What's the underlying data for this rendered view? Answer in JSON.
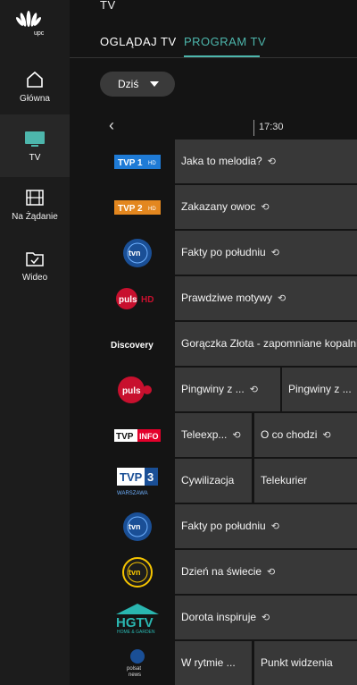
{
  "brand": {
    "logo_text": "upc"
  },
  "sidebar": {
    "items": [
      {
        "label": "Główna",
        "icon": "home-icon"
      },
      {
        "label": "TV",
        "icon": "tv-icon",
        "active": true
      },
      {
        "label": "Na Żądanie",
        "icon": "film-icon"
      },
      {
        "label": "Wideo",
        "icon": "folder-check-icon"
      }
    ]
  },
  "header": {
    "title": "TV",
    "tabs": [
      {
        "label": "OGLĄDAJ TV"
      },
      {
        "label": "PROGRAM TV",
        "active": true
      }
    ]
  },
  "day_selector": {
    "value": "Dziś"
  },
  "timeline": {
    "time": "17:30"
  },
  "colors": {
    "accent": "#4db6ac",
    "program_bg": "#383838"
  },
  "channels": [
    {
      "logo": "TVP 1 HD",
      "programs": [
        {
          "title": "Jaka to melodia?",
          "replay": true
        }
      ]
    },
    {
      "logo": "TVP 2 HD",
      "programs": [
        {
          "title": "Zakazany owoc",
          "replay": true
        }
      ]
    },
    {
      "logo": "tvn24",
      "programs": [
        {
          "title": "Fakty po południu",
          "replay": true
        }
      ]
    },
    {
      "logo": "puls HD",
      "programs": [
        {
          "title": "Prawdziwe motywy",
          "replay": true
        }
      ]
    },
    {
      "logo": "Discovery",
      "programs": [
        {
          "title": "Gorączka Złota - zapomniane kopalnie",
          "replay": false
        }
      ]
    },
    {
      "logo": "puls 2",
      "programs": [
        {
          "title": "Pingwiny z ...",
          "replay": true
        },
        {
          "title": "Pingwiny z ...",
          "replay": true
        }
      ]
    },
    {
      "logo": "TVP INFO",
      "programs": [
        {
          "title": "Teleexp...",
          "replay": true
        },
        {
          "title": "O co chodzi",
          "replay": true
        }
      ]
    },
    {
      "logo": "TVP 3 WARSZAWA",
      "programs": [
        {
          "title": "Cywilizacja",
          "replay": false
        },
        {
          "title": "Telekurier",
          "replay": false
        }
      ]
    },
    {
      "logo": "tvn24",
      "programs": [
        {
          "title": "Fakty po południu",
          "replay": true
        }
      ]
    },
    {
      "logo": "tvn24 bis",
      "programs": [
        {
          "title": "Dzień na świecie",
          "replay": true
        }
      ]
    },
    {
      "logo": "HGTV HOME & GARDEN",
      "programs": [
        {
          "title": "Dorota inspiruje",
          "replay": true
        }
      ]
    },
    {
      "logo": "polsat news",
      "programs": [
        {
          "title": "W rytmie ...",
          "replay": false
        },
        {
          "title": "Punkt widzenia",
          "replay": false
        }
      ]
    }
  ]
}
